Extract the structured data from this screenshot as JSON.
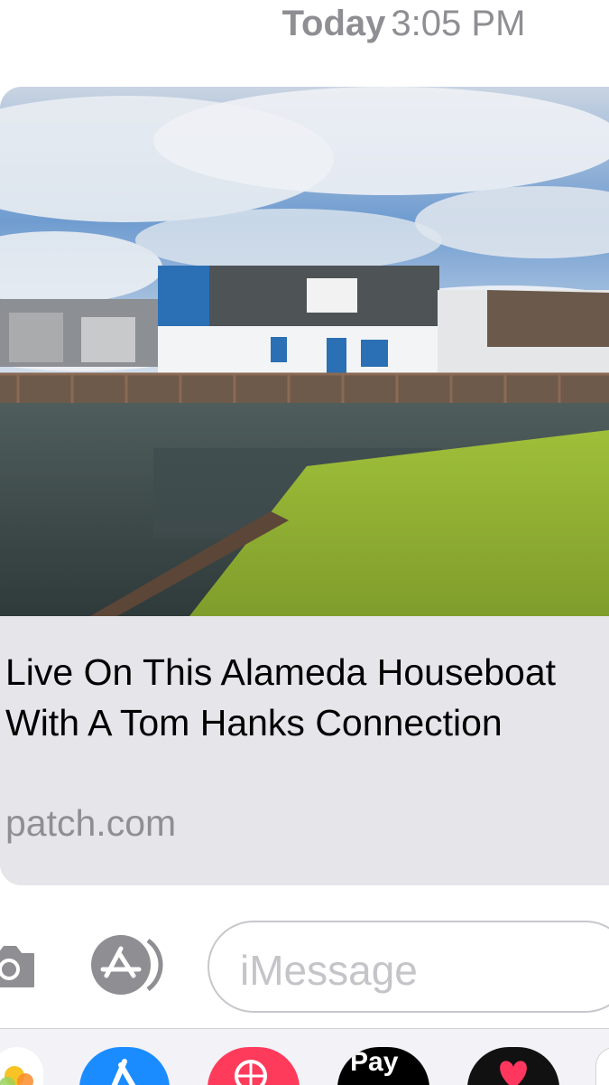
{
  "header": {
    "day": "Today",
    "time": "3:05 PM"
  },
  "link_preview": {
    "title": "Live On This Alameda Houseboat With A Tom Hanks Connection",
    "domain": "patch.com",
    "image": "houseboat-photo"
  },
  "compose": {
    "placeholder": "iMessage",
    "camera_icon": "camera-icon",
    "apps_icon": "app-store-icon"
  },
  "app_drawer": {
    "apps": [
      {
        "icon": "photos-icon"
      },
      {
        "icon": "app-store-icon"
      },
      {
        "icon": "images-search-icon"
      },
      {
        "icon": "apple-pay-icon",
        "label": "Pay"
      },
      {
        "icon": "digital-touch-icon"
      }
    ]
  },
  "colors": {
    "bubble_gray": "#e5e5ea",
    "secondary_text": "#8e8e93",
    "app_store_blue": "#1a8cff",
    "images_red": "#ff3b5c"
  }
}
